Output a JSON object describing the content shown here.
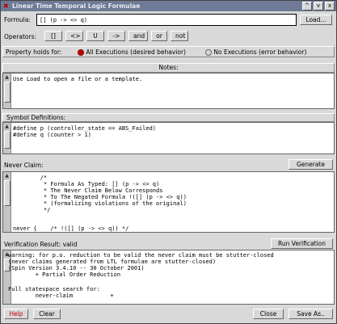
{
  "window": {
    "title": "Linear Time Temporal Logic Formulae",
    "icon": "x-icon",
    "controls": [
      "^",
      "v",
      "x"
    ]
  },
  "formula": {
    "label": "Formula:",
    "value": "[] (p -> <> q)",
    "load_button": "Load..."
  },
  "operators": {
    "label": "Operators:",
    "items": [
      "[]",
      "<>",
      "U",
      "->",
      "and",
      "or",
      "not"
    ]
  },
  "property": {
    "label": "Property holds for:",
    "option_all": "All Executions (desired behavior)",
    "option_none": "No Executions (error behavior)",
    "selected": "all"
  },
  "notes": {
    "header": "Notes:",
    "text": "Use Load to open a file or a template."
  },
  "symbols": {
    "header": "Symbol Definitions:",
    "lines": [
      "#define p (controller_state == ABS_Failed)",
      "#define q (counter > 1)"
    ]
  },
  "never_claim": {
    "label": "Never Claim:",
    "generate_button": "Generate",
    "lines": [
      "        /*",
      "         * Formula As Typed: [] (p -> <> q)",
      "         * The Never Claim Below Corresponds",
      "         * To The Negated Formula !([] (p -> <> q))",
      "         * (formalizing violations of the original)",
      "         */",
      "",
      "never {    /* !([] (p -> <> q)) */"
    ]
  },
  "verification": {
    "label": "Verification Result: valid",
    "run_button": "Run Verification",
    "lines": [
      "warning: for p.o. reduction to be valid the never claim must be stutter-closed",
      "(never claims generated from LTL formulae are stutter-closed)",
      "(Spin Version 3.4.10 -- 30 October 2001)",
      "        + Partial Order Reduction",
      "",
      "Full statespace search for:",
      "        never-claim           +"
    ]
  },
  "footer": {
    "help": "Help",
    "clear": "Clear",
    "close": "Close",
    "save_as": "Save As.."
  },
  "colors": {
    "title_bar": "#6f7a96",
    "help_text": "#c00000",
    "radio_selected": "#c00000"
  }
}
